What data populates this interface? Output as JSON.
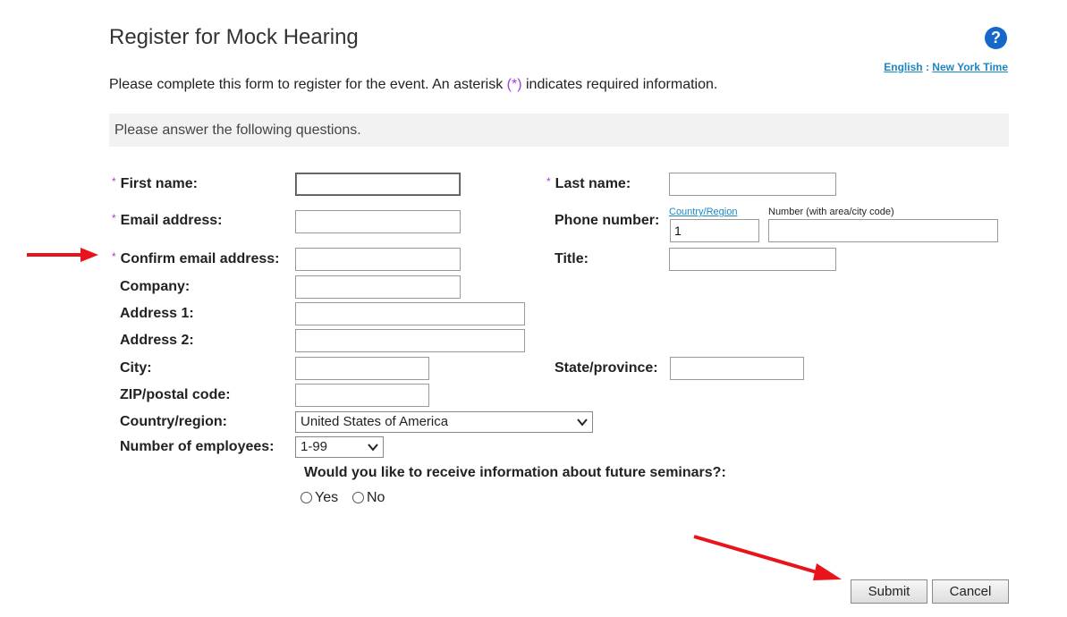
{
  "header": {
    "title": "Register for Mock Hearing",
    "help_glyph": "?",
    "language_link": "English",
    "separator": ":",
    "timezone_link": "New York Time"
  },
  "intro": {
    "before": "Please complete this form to register for the event. An asterisk ",
    "asterisk": "(*)",
    "after": " indicates required information."
  },
  "section": {
    "text": "Please answer the following questions."
  },
  "required_marker": "*",
  "fields": {
    "first_name": {
      "label": "First name:",
      "value": ""
    },
    "last_name": {
      "label": "Last name:",
      "value": ""
    },
    "email": {
      "label": "Email address:",
      "value": ""
    },
    "phone": {
      "label": "Phone number:",
      "country_link": "Country/Region",
      "country_code_value": "1",
      "number_label": "Number (with area/city code)",
      "number_value": ""
    },
    "confirm_email": {
      "label": "Confirm email address:",
      "value": ""
    },
    "title": {
      "label": "Title:",
      "value": ""
    },
    "company": {
      "label": "Company:",
      "value": ""
    },
    "address1": {
      "label": "Address 1:",
      "value": ""
    },
    "address2": {
      "label": "Address 2:",
      "value": ""
    },
    "city": {
      "label": "City:",
      "value": ""
    },
    "state": {
      "label": "State/province:",
      "value": ""
    },
    "zip": {
      "label": "ZIP/postal code:",
      "value": ""
    },
    "country": {
      "label": "Country/region:",
      "selected": "United States of America"
    },
    "employees": {
      "label": "Number of employees:",
      "selected": "1-99"
    }
  },
  "question": {
    "text": "Would you like to receive information about future seminars?:",
    "options": [
      "Yes",
      "No"
    ]
  },
  "buttons": {
    "submit": "Submit",
    "cancel": "Cancel"
  },
  "colors": {
    "annotation_arrow": "#e8141b",
    "required_asterisk": "#a040d8",
    "link": "#1a87c8",
    "help_icon": "#1668c8"
  },
  "icons": {
    "help": "question-circle-icon",
    "dropdown": "chevron-down-icon",
    "annotation": "red-arrow-icon"
  }
}
